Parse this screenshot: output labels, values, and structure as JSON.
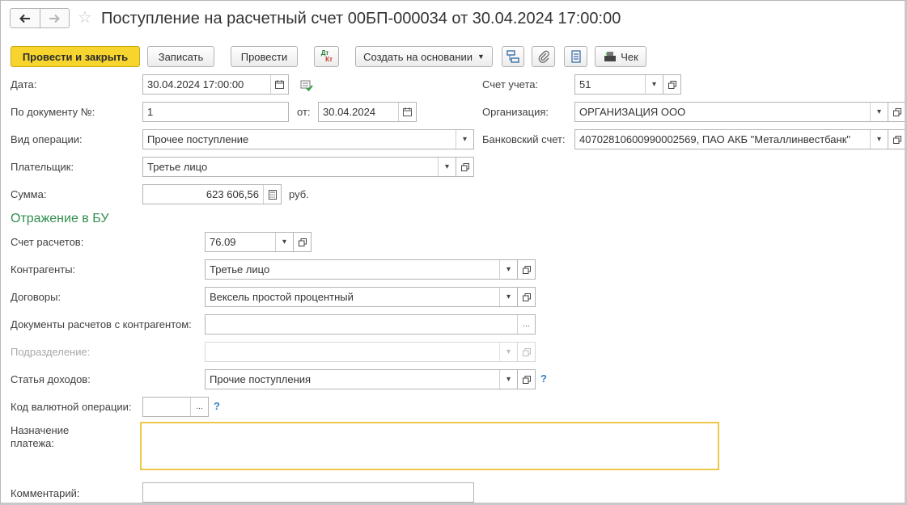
{
  "window": {
    "title": "Поступление на расчетный счет 00БП-000034 от 30.04.2024 17:00:00"
  },
  "toolbar": {
    "post_close": "Провести и закрыть",
    "save": "Записать",
    "post": "Провести",
    "dtkt_top": "Дт",
    "dtkt_bottom": "Кт",
    "create_based": "Создать на основании",
    "receipt": "Чек"
  },
  "form": {
    "date": {
      "label": "Дата:",
      "value": "30.04.2024 17:00:00"
    },
    "doc_no": {
      "label": "По документу №:",
      "value": "1",
      "from_label": "от:",
      "from_value": "30.04.2024"
    },
    "operation": {
      "label": "Вид операции:",
      "value": "Прочее поступление"
    },
    "payer": {
      "label": "Плательщик:",
      "value": "Третье лицо"
    },
    "amount": {
      "label": "Сумма:",
      "value": "623 606,56",
      "currency": "руб."
    },
    "account": {
      "label": "Счет учета:",
      "value": "51"
    },
    "organization": {
      "label": "Организация:",
      "value": "ОРГАНИЗАЦИЯ ООО"
    },
    "bank_account": {
      "label": "Банковский счет:",
      "value": "40702810600990002569, ПАО АКБ \"Металлинвестбанк\""
    }
  },
  "bu_section": {
    "title": "Отражение в БУ",
    "settlement_account": {
      "label": "Счет расчетов:",
      "value": "76.09"
    },
    "counterparties": {
      "label": "Контрагенты:",
      "value": "Третье лицо"
    },
    "contracts": {
      "label": "Договоры:",
      "value": "Вексель простой процентный"
    },
    "settlement_docs": {
      "label": "Документы расчетов с контрагентом:",
      "value": ""
    },
    "division": {
      "label": "Подразделение:",
      "value": ""
    },
    "income_item": {
      "label": "Статья доходов:",
      "value": "Прочие поступления"
    }
  },
  "currency_op": {
    "label": "Код валютной операции:",
    "value": ""
  },
  "purpose": {
    "label": "Назначение платежа:",
    "value": ""
  },
  "comment": {
    "label": "Комментарий:",
    "value": ""
  },
  "help_mark": "?",
  "ellipsis": "...",
  "colors": {
    "primary_button": "#f7d52e",
    "section_title": "#2f8f4e",
    "help": "#3c7ec0",
    "focus": "#ecc74a"
  }
}
